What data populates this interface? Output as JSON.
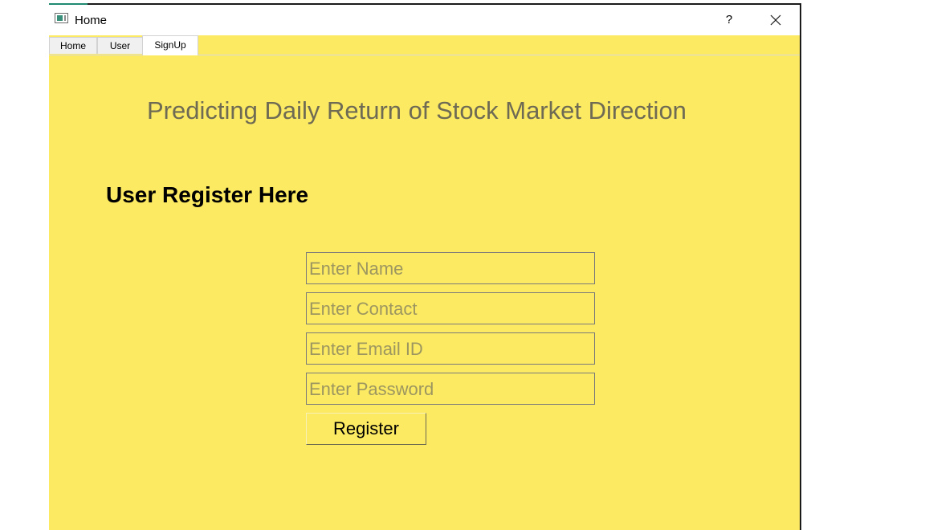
{
  "window": {
    "title": "Home",
    "help_label": "?",
    "close_icon": "close-icon",
    "app_icon": "window-app-icon"
  },
  "tabs": [
    {
      "label": "Home",
      "active": false
    },
    {
      "label": "User",
      "active": false
    },
    {
      "label": "SignUp",
      "active": true
    }
  ],
  "main": {
    "heading": "Predicting Daily Return of Stock Market Direction",
    "subheading": "User Register Here"
  },
  "form": {
    "name_placeholder": "Enter Name",
    "contact_placeholder": "Enter Contact",
    "email_placeholder": "Enter Email ID",
    "password_placeholder": "Enter Password",
    "register_label": "Register"
  },
  "colors": {
    "background": "#fbea62",
    "heading_text": "#6e6a54",
    "placeholder_text": "#9d9660"
  }
}
